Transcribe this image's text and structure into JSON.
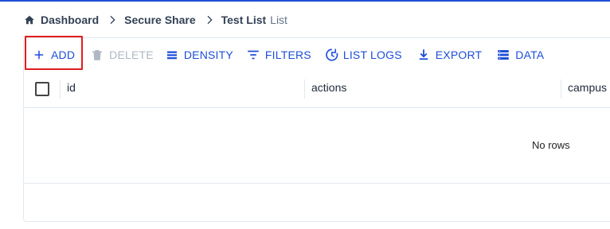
{
  "breadcrumb": {
    "items": [
      "Dashboard",
      "Secure Share"
    ],
    "current": "Test List",
    "current_suffix": "List"
  },
  "toolbar": {
    "add": "ADD",
    "delete": "DELETE",
    "density": "DENSITY",
    "filters": "FILTERS",
    "list_logs": "LIST LOGS",
    "export": "EXPORT",
    "data": "DATA"
  },
  "columns": [
    "id",
    "actions",
    "campus"
  ],
  "empty_message": "No rows",
  "colors": {
    "accent": "#1d4ed8",
    "highlight": "#e11d1d",
    "disabled": "#b0b8c4"
  }
}
